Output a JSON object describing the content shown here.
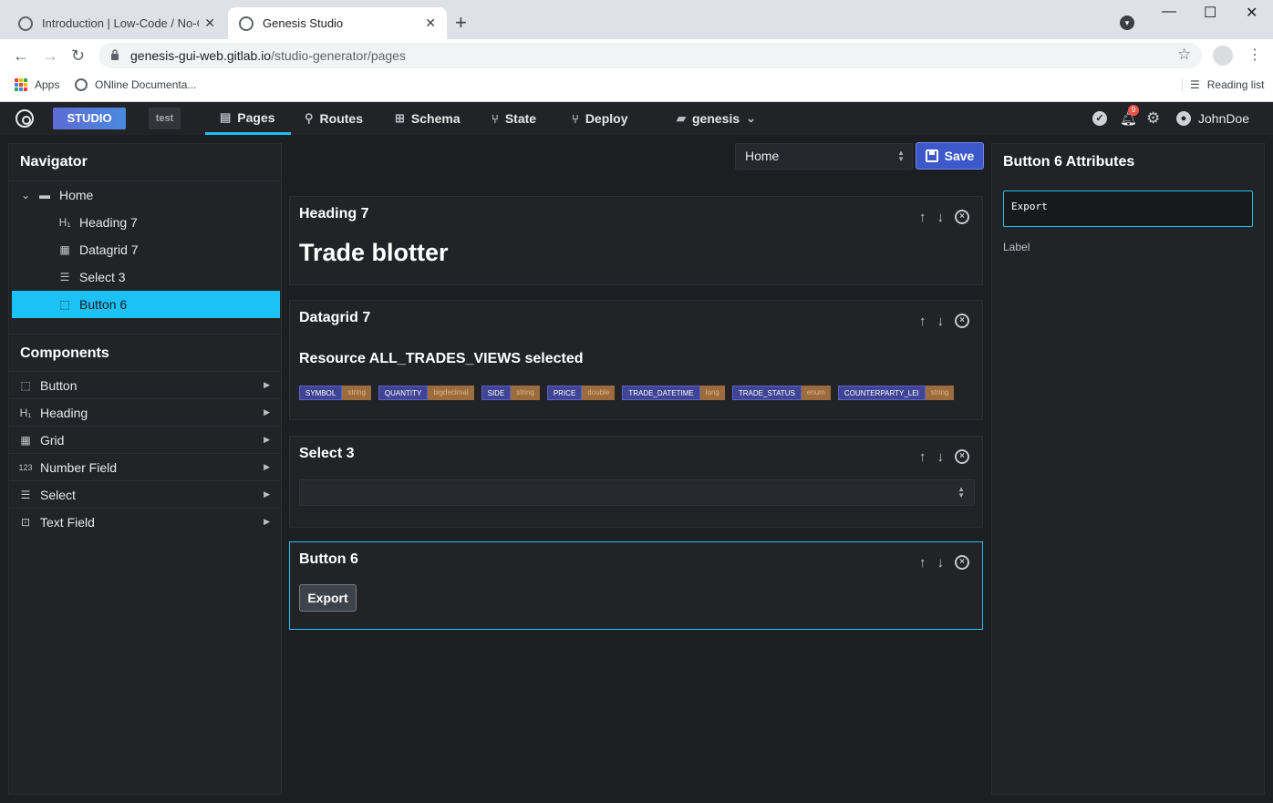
{
  "browser": {
    "tabs": [
      {
        "title": "Introduction | Low-Code / No-Code"
      },
      {
        "title": "Genesis Studio"
      }
    ],
    "url": {
      "host": "genesis-gui-web.gitlab.io",
      "path": "/studio-generator/pages"
    },
    "bookmarks": [
      {
        "label": "Apps"
      },
      {
        "label": "ONline Documenta..."
      }
    ],
    "reading_list": "Reading list"
  },
  "header": {
    "badge": "STUDIO",
    "env": "test",
    "nav": [
      "Pages",
      "Routes",
      "Schema",
      "State",
      "Deploy"
    ],
    "active_nav": "Pages",
    "project": "genesis",
    "notifications": "9",
    "user": "JohnDoe"
  },
  "navigator": {
    "title": "Navigator",
    "root": "Home",
    "items": [
      {
        "label": "Heading 7",
        "icon": "heading-icon"
      },
      {
        "label": "Datagrid 7",
        "icon": "grid-icon"
      },
      {
        "label": "Select 3",
        "icon": "select-icon"
      },
      {
        "label": "Button 6",
        "icon": "button-icon",
        "selected": true
      }
    ]
  },
  "components": {
    "title": "Components",
    "items": [
      {
        "label": "Button",
        "icon": "button-icon"
      },
      {
        "label": "Heading",
        "icon": "heading-icon"
      },
      {
        "label": "Grid",
        "icon": "grid-icon"
      },
      {
        "label": "Number Field",
        "icon": "number-icon"
      },
      {
        "label": "Select",
        "icon": "select-icon"
      },
      {
        "label": "Text Field",
        "icon": "text-field-icon"
      }
    ]
  },
  "editor": {
    "page_select": "Home",
    "save_label": "Save",
    "cards": {
      "heading": {
        "title": "Heading 7",
        "text": "Trade blotter"
      },
      "datagrid": {
        "title": "Datagrid 7",
        "resource": "Resource ALL_TRADES_VIEWS selected",
        "fields": [
          {
            "name": "SYMBOL",
            "type": "string"
          },
          {
            "name": "QUANTITY",
            "type": "bigdecimal"
          },
          {
            "name": "SIDE",
            "type": "string"
          },
          {
            "name": "PRICE",
            "type": "double"
          },
          {
            "name": "TRADE_DATETIME",
            "type": "long"
          },
          {
            "name": "TRADE_STATUS",
            "type": "enum"
          },
          {
            "name": "COUNTERPARTY_LEI",
            "type": "string"
          }
        ]
      },
      "select": {
        "title": "Select 3",
        "value": ""
      },
      "button": {
        "title": "Button 6",
        "label": "Export"
      }
    }
  },
  "attributes": {
    "title": "Button 6 Attributes",
    "value": "Export",
    "field_label": "Label"
  },
  "colors": {
    "accent": "#1fbdf4",
    "save": "#3d58c9",
    "background": "#1d1e22",
    "panel": "#222327"
  }
}
